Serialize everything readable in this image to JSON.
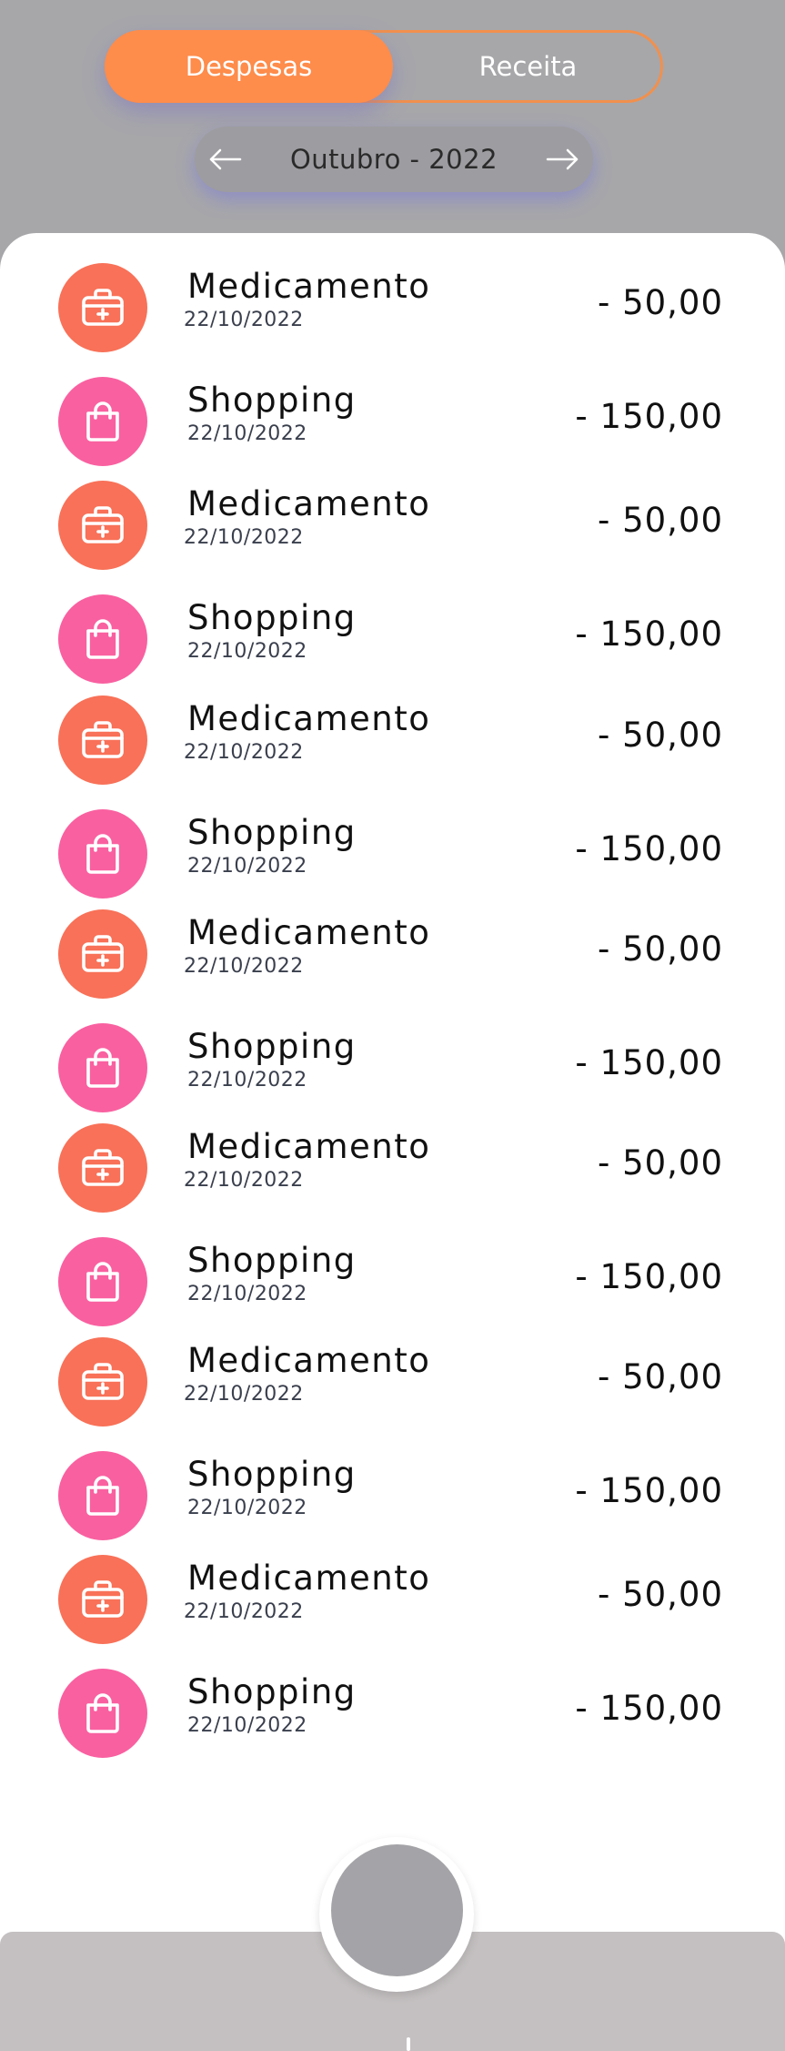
{
  "tabs": {
    "expenses_label": "Despesas",
    "income_label": "Receita",
    "active": "Despesas"
  },
  "month_selector": {
    "label": "Outubro - 2022",
    "prev_icon": "arrow-left-icon",
    "next_icon": "arrow-right-icon"
  },
  "colors": {
    "accent_orange": "#fe8c4b",
    "medicine_icon_bg": "#f87158",
    "shopping_icon_bg": "#f960a0",
    "background_gray": "#a7a7aa",
    "sheet_white": "#ffffff",
    "bottom_bar": "#c4c0c1",
    "fab": "#a4a4a8"
  },
  "transactions": [
    {
      "category": "medicine",
      "icon": "medical-kit-icon",
      "title": "Medicamento",
      "date": "22/10/2022",
      "amount": "- 50,00"
    },
    {
      "category": "shopping",
      "icon": "shopping-bag-icon",
      "title": "Shopping",
      "date": "22/10/2022",
      "amount": "- 150,00"
    },
    {
      "category": "medicine",
      "icon": "medical-kit-icon",
      "title": "Medicamento",
      "date": "22/10/2022",
      "amount": "- 50,00"
    },
    {
      "category": "shopping",
      "icon": "shopping-bag-icon",
      "title": "Shopping",
      "date": "22/10/2022",
      "amount": "- 150,00"
    },
    {
      "category": "medicine",
      "icon": "medical-kit-icon",
      "title": "Medicamento",
      "date": "22/10/2022",
      "amount": "- 50,00"
    },
    {
      "category": "shopping",
      "icon": "shopping-bag-icon",
      "title": "Shopping",
      "date": "22/10/2022",
      "amount": "- 150,00"
    },
    {
      "category": "medicine",
      "icon": "medical-kit-icon",
      "title": "Medicamento",
      "date": "22/10/2022",
      "amount": "- 50,00"
    },
    {
      "category": "shopping",
      "icon": "shopping-bag-icon",
      "title": "Shopping",
      "date": "22/10/2022",
      "amount": "- 150,00"
    },
    {
      "category": "medicine",
      "icon": "medical-kit-icon",
      "title": "Medicamento",
      "date": "22/10/2022",
      "amount": "- 50,00"
    },
    {
      "category": "shopping",
      "icon": "shopping-bag-icon",
      "title": "Shopping",
      "date": "22/10/2022",
      "amount": "- 150,00"
    },
    {
      "category": "medicine",
      "icon": "medical-kit-icon",
      "title": "Medicamento",
      "date": "22/10/2022",
      "amount": "- 50,00"
    },
    {
      "category": "shopping",
      "icon": "shopping-bag-icon",
      "title": "Shopping",
      "date": "22/10/2022",
      "amount": "- 150,00"
    },
    {
      "category": "medicine",
      "icon": "medical-kit-icon",
      "title": "Medicamento",
      "date": "22/10/2022",
      "amount": "- 50,00"
    },
    {
      "category": "shopping",
      "icon": "shopping-bag-icon",
      "title": "Shopping",
      "date": "22/10/2022",
      "amount": "- 150,00"
    }
  ],
  "bottom_nav": {
    "fab_icon": "add-button"
  }
}
